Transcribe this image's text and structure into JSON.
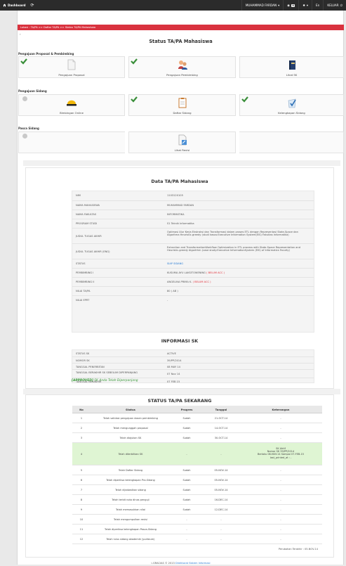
{
  "navbar": {
    "dashboard_label": "Dashboard",
    "user_name": "MUHAMMAD FARDAN",
    "messages_count": "0",
    "lang_label": "En",
    "logout_label": "KELUAR"
  },
  "breadcrumb": "Lokasi : TA/PA >> Daftar TA/PA >> Status TA/PA Mahasiswa",
  "page_title": "Status TA/PA Mahasiswa",
  "sections": {
    "pengajuan": "Pengajuan Proposal & Pembimbing",
    "sidang": "Pengajuan Sidang",
    "pasca": "Pasca Sidang"
  },
  "cards": {
    "proposal": "Pengajuan Proposal",
    "pembimbing": "Pengajuan Pembimbing",
    "sk": "Lihat SK",
    "bimbingan": "Bimbingan Online",
    "daftar_sidang": "Daftar Sidang",
    "kelengkapan": "Kelengkapan Sidang",
    "revisi": "Lihat Revisi"
  },
  "data_title": "Data TA/PA Mahasiswa",
  "data_rows": [
    {
      "k": "NIM",
      "v": "1103120105"
    },
    {
      "k": "NAMA MAHASISWA",
      "v": "MUHAMMAD FARDAN"
    },
    {
      "k": "NAMA FAKULTAS",
      "v": "INFORMATIKA"
    },
    {
      "k": "PROGRAM STUDI",
      "v": "S1 Teknik Informatika"
    },
    {
      "k": "JUDUL TUGAS AKHIR",
      "v": "Optimasi Alur Kerja Ekstraksi dan Transformasi dalam proses ETL dengan Representasi State-Space dan Algoritma Heuristic-greedy (studi kasus:Executive Information System(EIS) Fakultas Informatika)"
    },
    {
      "k": "JUDUL TUGAS AKHIR (ENG)",
      "v": "Extraction and TransformationWorkflow Optimization in ETL process with State-Space Representation and Heuristic-greedy Algorithm (case study:Executive InformationSystem (EIS) of Informatics Faculty)"
    },
    {
      "k": "STATUS",
      "v": "SIAP SIDANG"
    },
    {
      "k": "PEMBIMBING I",
      "v": "KUSUMA AYU LAKSITOWENING",
      "note": "( BELUM ACC )"
    },
    {
      "k": "PEMBIMBING II",
      "v": "ANGELINA PRIMA K.",
      "note": "( BELUM ACC )"
    },
    {
      "k": "NILAI TA/PA",
      "v": "80 ( AB )"
    },
    {
      "k": "NILAI EPRT",
      "v": "-"
    }
  ],
  "sk_title": "INFORMASI SK",
  "sk_rows": [
    {
      "k": "STATUS SK",
      "v": "ACTIVE"
    },
    {
      "k": "NOMOR SK",
      "v": "39/PP/2014"
    },
    {
      "k": "TANGGAL PENERBITAN",
      "v": "08 MAY 14"
    },
    {
      "k": "TANGGAL BERAKHIR SK SEBELUM DIPERPANJANG",
      "v": "07 Nov 14"
    },
    {
      "k": "TANGGAL BERAKHIR",
      "v": "07 FEB 15"
    }
  ],
  "approved": {
    "tag": "[APPROVED]",
    "text": " SK Anda Telah Diperpanjang"
  },
  "status_title": "STATUS TA/PA SEKARANG",
  "status_headers": {
    "no": "No",
    "status": "Status",
    "progres": "Progres",
    "tanggal": "Tanggal",
    "ket": "Keterangan"
  },
  "status_rows": [
    {
      "no": "1",
      "status": "Telah validasi pengajuan dosen pembimbing",
      "progres": "Sudah",
      "tanggal": "21-OCT-14",
      "ket": "-"
    },
    {
      "no": "2",
      "status": "Telah mengunggah proposal",
      "progres": "Sudah",
      "tanggal": "14-OCT-14",
      "ket": "-"
    },
    {
      "no": "3",
      "status": "Telah diajukan SK",
      "progres": "Sudah",
      "tanggal": "30-OCT-14",
      "ket": "-"
    },
    {
      "no": "4",
      "status": "Telah diterbitkan SK",
      "progres": "-",
      "tanggal": "-",
      "ket_l1": "SK Aktif",
      "ket_l2": "Nomor SK 39/PP/2014",
      "ket_l3": "Berlaku 08-MAY-14 Sampai 07-FEB-15",
      "ket_l4": "last_printed_at : -"
    },
    {
      "no": "5",
      "status": "Telah Daftar Sidang",
      "progres": "Sudah",
      "tanggal": "05-NOV-14",
      "ket": "-"
    },
    {
      "no": "6",
      "status": "Telah diperiksa kelengkapan Pra-Sidang",
      "progres": "Sudah",
      "tanggal": "05-NOV-14",
      "ket": "-"
    },
    {
      "no": "7",
      "status": "Telah dijadwalkan sidang",
      "progres": "Sudah",
      "tanggal": "05-NOV-14",
      "ket": "-"
    },
    {
      "no": "8",
      "status": "Telah terbit nota dinas penguji",
      "progres": "Sudah",
      "tanggal": "16-DEC-14",
      "ket": "-"
    },
    {
      "no": "9",
      "status": "Telah memasukkan nilai",
      "progres": "Sudah",
      "tanggal": "12-DEC-14",
      "ket": "-"
    },
    {
      "no": "10",
      "status": "Telah mengumpulkan revisi",
      "progres": "-",
      "tanggal": "-",
      "ket": "-"
    },
    {
      "no": "11",
      "status": "Telah diperiksa kelengkapan Pasca-Sidang",
      "progres": "-",
      "tanggal": "-",
      "ket": "-"
    },
    {
      "no": "12",
      "status": "Telah lulus sidang akademik (yudisium)",
      "progres": "-",
      "tanggal": "-",
      "ket": "-"
    }
  ],
  "last_update": "Perubahan Terakhir : 05-NOV-14",
  "footer": {
    "prefix": "i-GRACIAS © 2013 ",
    "link": "Direktorat Sistem Informasi"
  }
}
